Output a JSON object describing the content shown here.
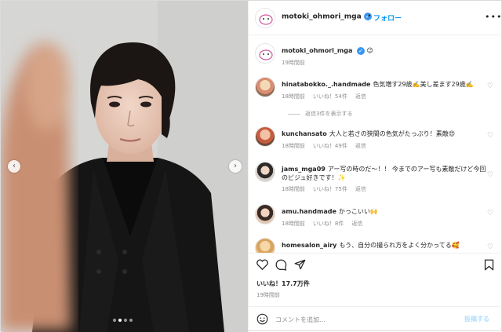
{
  "post": {
    "username": "motoki_ohmori_mga",
    "follow_label": "フォロー",
    "separator": "•",
    "more_label": "•••"
  },
  "caption": {
    "username": "motoki_ohmori_mga",
    "text": "😉",
    "time": "19時間前"
  },
  "comments": [
    {
      "username": "hinatabokko._.handmade",
      "text": "色気増す29歳✍️美し差ます29歳✍️",
      "time": "18時間前",
      "likes": "いいね！54件",
      "reply": "返信",
      "view_replies": "返信3件を表示する"
    },
    {
      "username": "kunchansato",
      "text": "大人と若さの狭間の色気がたっぷり！素敵😍",
      "time": "18時間前",
      "likes": "いいね！49件",
      "reply": "返信"
    },
    {
      "username": "jams_mga09",
      "text": "アー写の時のだ〜！！ 今までのアー写も素敵だけど今回のビジュ好きです！✨",
      "time": "18時間前",
      "likes": "いいね！75件",
      "reply": "返信"
    },
    {
      "username": "amu.handmade",
      "text": "かっこいい🙌",
      "time": "18時間前",
      "likes": "いいね！8件",
      "reply": "返信"
    },
    {
      "username": "homesalon_airy",
      "text": "もう、自分の撮られ方をよく分かってる🥰",
      "time": "",
      "likes": "",
      "reply": ""
    }
  ],
  "actions": {
    "likes": "いいね！17.7万件",
    "time": "19時間前"
  },
  "compose": {
    "placeholder": "コメントを追加...",
    "post_label": "投稿する"
  },
  "carousel": {
    "count": 4,
    "active": 1
  },
  "icons": [
    "chevron-left-icon",
    "chevron-right-icon",
    "verified-icon",
    "heart-icon",
    "comment-icon",
    "share-icon",
    "bookmark-icon",
    "emoji-icon",
    "more-icon"
  ],
  "colors": {
    "accent": "#0095f6",
    "verified": "#3897f0",
    "muted": "#8e8e8e",
    "text": "#262626"
  }
}
